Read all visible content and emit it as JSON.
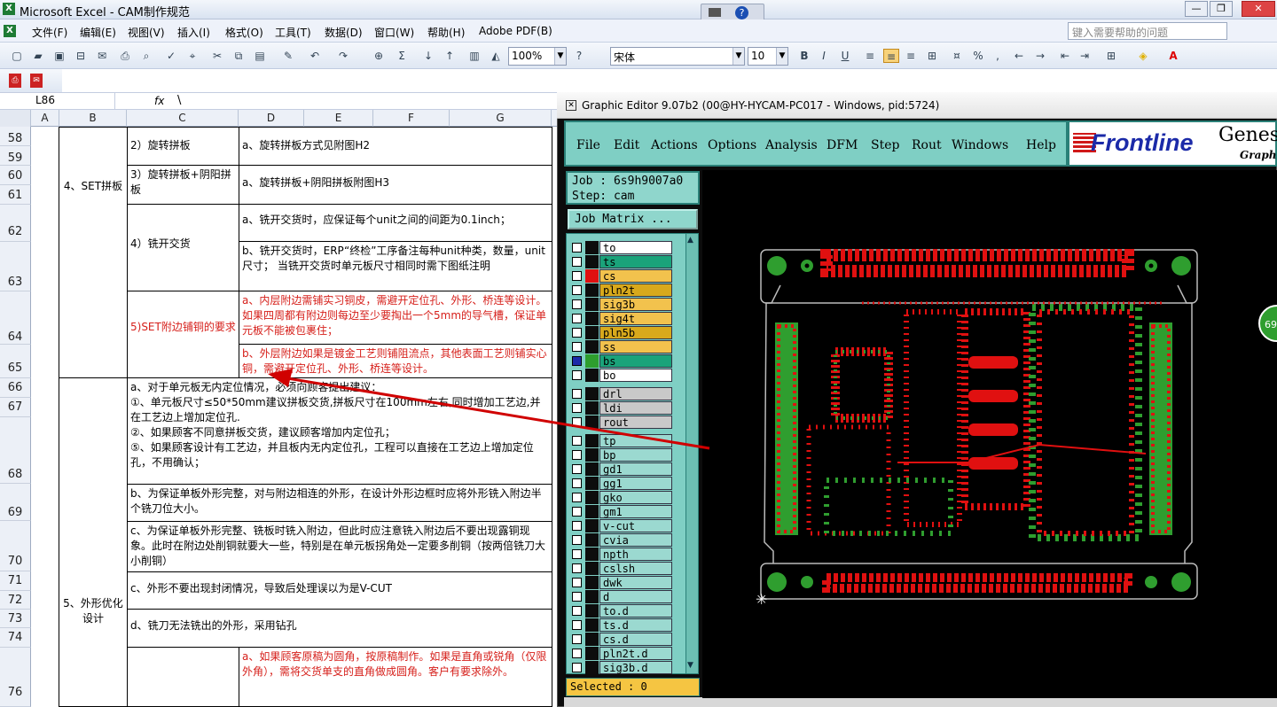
{
  "excel": {
    "title": "Microsoft Excel - CAM制作规范",
    "menu": [
      "文件(F)",
      "编辑(E)",
      "视图(V)",
      "插入(I)",
      "格式(O)",
      "工具(T)",
      "数据(D)",
      "窗口(W)",
      "帮助(H)",
      "Adobe PDF(B)"
    ],
    "help_placeholder": "键入需要帮助的问题",
    "zoom": "100%",
    "font_name": "宋体",
    "font_size": "10",
    "name_box": "L86",
    "fx": "fx",
    "formula": "\\",
    "columns": [
      "A",
      "B",
      "C",
      "D",
      "E",
      "F",
      "G"
    ],
    "rows": [
      "58",
      "59",
      "60",
      "61",
      "62",
      "63",
      "64",
      "65",
      "66",
      "67",
      "68",
      "69",
      "70",
      "71",
      "72",
      "73",
      "74",
      "76"
    ],
    "cells": {
      "b_set": "4、SET拼板",
      "b_shape": "5、外形优化设计",
      "c1": "2）旋转拼板",
      "d1": "a、旋转拼板方式见附图H2",
      "c2": "3）旋转拼板+阴阳拼板",
      "d2": "a、旋转拼板+阴阳拼板附图H3",
      "c3": "4）铣开交货",
      "d3a": "a、铣开交货时，应保证每个unit之间的间距为0.1inch；",
      "d3b": "b、铣开交货时，ERP“终检”工序备注每种unit种类，数量，unit尺寸；  当铣开交货时单元板尺寸相同时需下图纸注明",
      "c4": "5)SET附边铺铜的要求",
      "d4a": "a、内层附边需铺实习铜皮，需避开定位孔、外形、桥连等设计。如果四周都有附边则每边至少要掏出一个5mm的导气槽，保证单元板不能被包裹住；",
      "d4b": "b、外层附边如果是镀金工艺则铺阻流点，其他表面工艺则铺实心铜，需避开定位孔、外形、桥连等设计。",
      "s1": "a、对于单元板无内定位情况，必须向顾客提出建议：\n①、单元板尺寸≤50*50mm建议拼板交货,拼板尺寸在100mm左右,同时增加工艺边,并在工艺边上增加定位孔.\n②、如果顾客不同意拼板交货，建议顾客增加内定位孔；\n⑤、如果顾客设计有工艺边，并且板内无内定位孔，工程可以直接在工艺边上增加定位孔，不用确认；",
      "s2": "b、为保证单板外形完整，对与附边相连的外形，在设计外形边框时应将外形铣入附边半个铣刀位大小。",
      "s3": "c、为保证单板外形完整、铣板时铣入附边，但此时应注意铣入附边后不要出现露铜现象。此时在附边处削铜就要大一些，特别是在单元板拐角处一定要多削铜（按两倍铣刀大小削铜）",
      "s4": "c、外形不要出现封闭情况，导致后处理误以为是V-CUT",
      "s5": "d、铣刀无法铣出的外形，采用钻孔",
      "s6": "a、如果顾客原稿为圆角，按原稿制作。如果是直角或锐角（仅限外角），需将交货单支的直角做成圆角。客户有要求除外。"
    }
  },
  "genesis": {
    "title": "Graphic Editor 9.07b2 (00@HY-HYCAM-PC017 - Windows, pid:5724)",
    "menu": [
      "File",
      "Edit",
      "Actions",
      "Options",
      "Analysis",
      "DFM",
      "Step",
      "Rout",
      "Windows",
      "Help"
    ],
    "logo_text": "Frontline",
    "logo_right": "Genes",
    "logo_sub": "Graphi",
    "job": "Job : 6s9h9007a0",
    "step": "Step: cam",
    "job_matrix": "Job Matrix ...",
    "selected": "Selected : 0",
    "badge": "69",
    "layers": [
      {
        "name": "to",
        "fill": "#ffffff",
        "swatch": "#0d0d0d"
      },
      {
        "name": "ts",
        "fill": "#1aa37a",
        "swatch": "#0d0d0d"
      },
      {
        "name": "cs",
        "fill": "#f2c24d",
        "swatch": "#e01010"
      },
      {
        "name": "pln2t",
        "fill": "#d8a91c",
        "swatch": "#0d0d0d"
      },
      {
        "name": "sig3b",
        "fill": "#f2c24d",
        "swatch": "#0d0d0d"
      },
      {
        "name": "sig4t",
        "fill": "#f2c24d",
        "swatch": "#0d0d0d"
      },
      {
        "name": "pln5b",
        "fill": "#d8a91c",
        "swatch": "#0d0d0d"
      },
      {
        "name": "ss",
        "fill": "#f2c24d",
        "swatch": "#0d0d0d"
      },
      {
        "name": "bs",
        "fill": "#1aa37a",
        "swatch": "#2e9e2e"
      },
      {
        "name": "bo",
        "fill": "#ffffff",
        "swatch": "#0d0d0d"
      },
      {
        "name": "drl",
        "fill": "#c9c9c9",
        "swatch": "#0d0d0d"
      },
      {
        "name": "ldi",
        "fill": "#c9c9c9",
        "swatch": "#0d0d0d"
      },
      {
        "name": "rout",
        "fill": "#c9c9c9",
        "swatch": "#0d0d0d"
      },
      {
        "name": "tp",
        "fill": "#9bd9d0",
        "swatch": "#0d0d0d"
      },
      {
        "name": "bp",
        "fill": "#9bd9d0",
        "swatch": "#0d0d0d"
      },
      {
        "name": "gd1",
        "fill": "#9bd9d0",
        "swatch": "#0d0d0d"
      },
      {
        "name": "gg1",
        "fill": "#9bd9d0",
        "swatch": "#0d0d0d"
      },
      {
        "name": "gko",
        "fill": "#9bd9d0",
        "swatch": "#0d0d0d"
      },
      {
        "name": "gm1",
        "fill": "#9bd9d0",
        "swatch": "#0d0d0d"
      },
      {
        "name": "v-cut",
        "fill": "#9bd9d0",
        "swatch": "#0d0d0d"
      },
      {
        "name": "cvia",
        "fill": "#9bd9d0",
        "swatch": "#0d0d0d"
      },
      {
        "name": "npth",
        "fill": "#9bd9d0",
        "swatch": "#0d0d0d"
      },
      {
        "name": "cslsh",
        "fill": "#9bd9d0",
        "swatch": "#0d0d0d"
      },
      {
        "name": "dwk",
        "fill": "#9bd9d0",
        "swatch": "#0d0d0d"
      },
      {
        "name": "d",
        "fill": "#9bd9d0",
        "swatch": "#0d0d0d"
      },
      {
        "name": "to.d",
        "fill": "#9bd9d0",
        "swatch": "#0d0d0d"
      },
      {
        "name": "ts.d",
        "fill": "#9bd9d0",
        "swatch": "#0d0d0d"
      },
      {
        "name": "cs.d",
        "fill": "#9bd9d0",
        "swatch": "#0d0d0d"
      },
      {
        "name": "pln2t.d",
        "fill": "#9bd9d0",
        "swatch": "#0d0d0d"
      },
      {
        "name": "sig3b.d",
        "fill": "#9bd9d0",
        "swatch": "#0d0d0d"
      }
    ]
  },
  "colors": {
    "pcb_green": "#2f9e2f",
    "pcb_red": "#e01010",
    "panel": "#7fcfc4",
    "arrow": "#d00000"
  }
}
